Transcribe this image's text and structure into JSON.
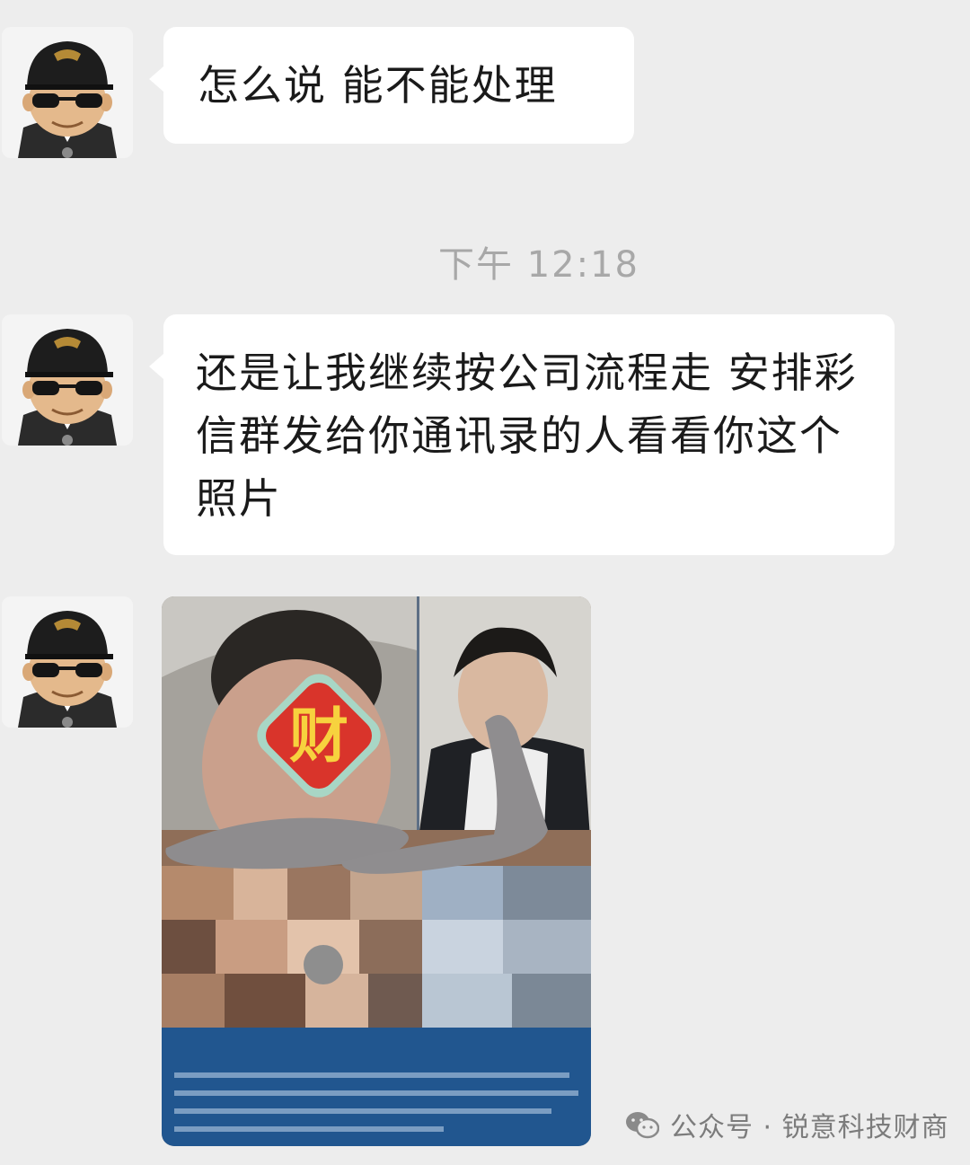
{
  "messages": [
    {
      "sender": "avatar-sunglasses",
      "text": "怎么说 能不能处理"
    },
    {
      "sender": "avatar-sunglasses",
      "text": "还是让我继续按公司流程走 安排彩信群发给你通讯录的人看看你这个照片"
    },
    {
      "sender": "avatar-sunglasses",
      "type": "image",
      "badge": "财"
    }
  ],
  "timestamp": "下午 12:18",
  "watermark": {
    "text": "公众号 · 锐意科技财商",
    "icon": "wechat-icon"
  },
  "colors": {
    "background": "#ededed",
    "bubble": "#ffffff",
    "timestamp": "#a8a8a8",
    "badge_red": "#d9342b",
    "badge_yellow": "#f7d23e"
  }
}
